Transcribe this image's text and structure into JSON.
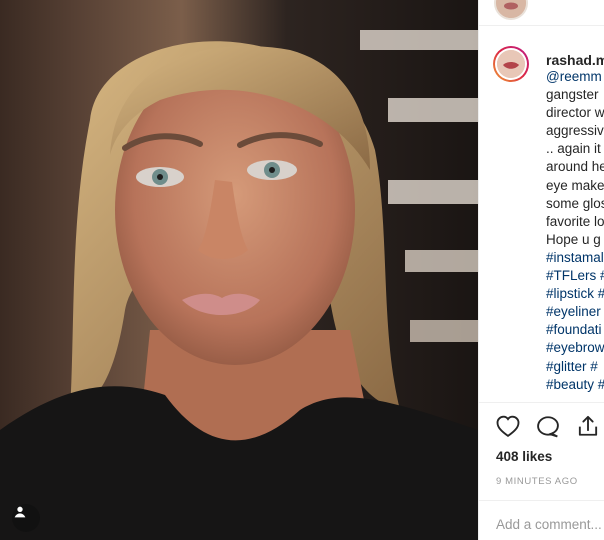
{
  "post": {
    "username": "rashad.m",
    "caption_lines": [
      {
        "text": "@reemm",
        "link": true
      },
      {
        "text": "gangster",
        "link": false
      },
      {
        "text": "director w",
        "link": false
      },
      {
        "text": "aggressiv",
        "link": false
      },
      {
        "text": ".. again it",
        "link": false
      },
      {
        "text": "around he",
        "link": false
      },
      {
        "text": "eye make",
        "link": false
      },
      {
        "text": "some glos",
        "link": false
      },
      {
        "text": "favorite lo",
        "link": false
      },
      {
        "text": "Hope u g",
        "link": false
      },
      {
        "text": "#instamal",
        "link": true
      },
      {
        "text": "#TFLers #",
        "link": true
      },
      {
        "text": "#lipstick #",
        "link": true
      },
      {
        "text": "#eyeliner",
        "link": true
      },
      {
        "text": "#foundati",
        "link": true
      },
      {
        "text": "#eyebrow",
        "link": true
      },
      {
        "text": "#glitter #",
        "link": true
      },
      {
        "text": "#beauty #",
        "link": true
      }
    ],
    "likes": "408 likes",
    "time": "9 MINUTES AGO",
    "comment_placeholder": "Add a comment..."
  },
  "icons": {
    "like": "heart-icon",
    "comment": "comment-icon",
    "share": "share-icon",
    "user_tag": "user-icon"
  },
  "colors": {
    "text": "#262626",
    "link": "#003569",
    "muted": "#999999",
    "avatar_ring": "#dc2743"
  }
}
